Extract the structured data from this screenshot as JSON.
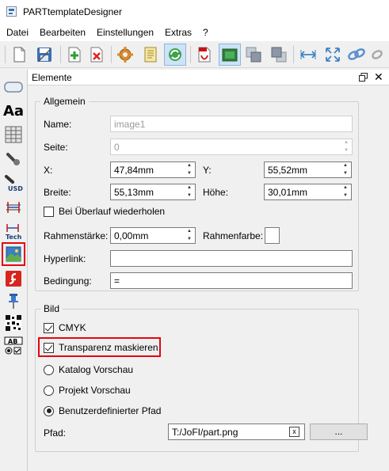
{
  "window": {
    "title": "PARTtemplateDesigner"
  },
  "menu": [
    "Datei",
    "Bearbeiten",
    "Einstellungen",
    "Extras",
    "?"
  ],
  "toolbar_icons": [
    "new-file-icon",
    "save-icon",
    "add-icon",
    "delete-icon",
    "settings-icon",
    "notes-icon",
    "refresh-icon",
    "pdf-export-icon",
    "image-export-icon",
    "bring-forward-icon",
    "send-backward-icon",
    "fit-width-icon",
    "fit-page-icon",
    "link-icon",
    "unlink-icon"
  ],
  "toolstrip_icons": [
    "frame-icon",
    "text-icon",
    "table-icon",
    "tuning-icon",
    "usd-price-icon",
    "dimension-icon",
    "tech-dimension-icon",
    "image-icon",
    "flash-icon",
    "pin-icon",
    "qr-code-icon",
    "form-field-icon"
  ],
  "panel": {
    "title": "Elemente",
    "general": {
      "title": "Allgemein",
      "name_label": "Name:",
      "name_value": "image1",
      "page_label": "Seite:",
      "page_value": "0",
      "x_label": "X:",
      "x_value": "47,84mm",
      "y_label": "Y:",
      "y_value": "55,52mm",
      "width_label": "Breite:",
      "width_value": "55,13mm",
      "height_label": "Höhe:",
      "height_value": "30,01mm",
      "repeat_label": "Bei Überlauf wiederholen",
      "frame_width_label": "Rahmenstärke:",
      "frame_width_value": "0,00mm",
      "frame_color_label": "Rahmenfarbe:",
      "hyperlink_label": "Hyperlink:",
      "hyperlink_value": "",
      "condition_label": "Bedingung:",
      "condition_value": "="
    },
    "image": {
      "title": "Bild",
      "cmyk_label": "CMYK",
      "mask_label": "Transparenz maskieren",
      "catalog_preview_label": "Katalog Vorschau",
      "project_preview_label": "Projekt Vorschau",
      "custom_path_label": "Benutzerdefinierter Pfad",
      "path_label": "Pfad:",
      "path_value": "T:/JoFI/part.png",
      "browse_label": "...",
      "clear_label": "x"
    }
  }
}
